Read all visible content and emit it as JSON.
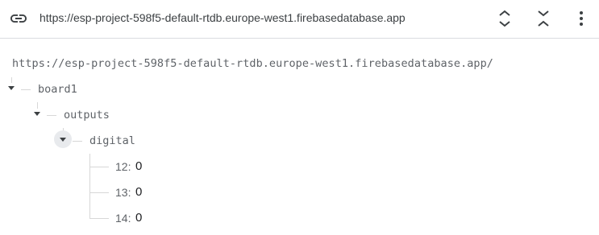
{
  "toolbar": {
    "url": "https://esp-project-598f5-default-rtdb.europe-west1.firebasedatabase.app"
  },
  "icons": {
    "link": "link-icon",
    "expand": "expand-all-icon",
    "collapse": "collapse-all-icon",
    "more": "more-vert-icon"
  },
  "tree": {
    "root_path": "https://esp-project-598f5-default-rtdb.europe-west1.firebasedatabase.app/",
    "board": {
      "key": "board1"
    },
    "outputs": {
      "key": "outputs"
    },
    "digital": {
      "key": "digital"
    },
    "leaves": [
      {
        "key": "12:",
        "value": "0"
      },
      {
        "key": "13:",
        "value": "0"
      },
      {
        "key": "14:",
        "value": "0"
      }
    ]
  },
  "colors": {
    "text_primary": "#202124",
    "text_secondary": "#5f6368",
    "divider": "#dadce0",
    "tree_line": "#d7d7d7"
  }
}
